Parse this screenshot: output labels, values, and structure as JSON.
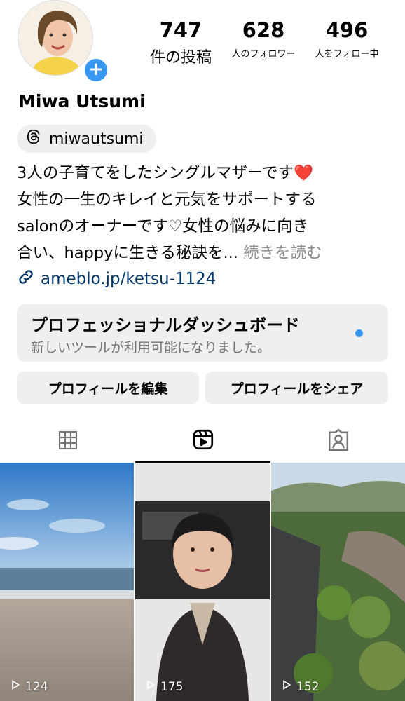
{
  "profile": {
    "name": "Miwa Utsumi",
    "add_badge": "+"
  },
  "stats": {
    "posts_count": "747",
    "posts_label": "件の投稿",
    "followers_count": "628",
    "followers_label": "人のフォロワー",
    "following_count": "496",
    "following_label": "人をフォロー中"
  },
  "threads": {
    "icon": "threads-icon",
    "handle": "miwautsumi"
  },
  "bio": {
    "line1": "3人の子育てをしたシングルマザーです❤️",
    "line2": "女性の一生のキレイと元気をサポートする",
    "line3": "salonのオーナーです♡女性の悩みに向き",
    "line4": "合い、happyに生きる秘訣を...",
    "more": "続きを読む"
  },
  "link": {
    "icon": "link-icon",
    "text": "ameblo.jp/ketsu-1124"
  },
  "dashboard": {
    "title": "プロフェッショナルダッシュボード",
    "subtitle": "新しいツールが利用可能になりました。",
    "dot_color": "#3897f0"
  },
  "buttons": {
    "edit": "プロフィールを編集",
    "share": "プロフィールをシェア"
  },
  "tabs": [
    {
      "icon": "grid-icon",
      "selected": false
    },
    {
      "icon": "reels-icon",
      "selected": true
    },
    {
      "icon": "tagged-icon",
      "selected": false
    }
  ],
  "reels": [
    {
      "views": "124"
    },
    {
      "views": "175"
    },
    {
      "views": "152"
    }
  ],
  "colors": {
    "accent": "#3897f0",
    "link": "#00376b",
    "chip_bg": "#efefef",
    "muted_text": "#737373"
  }
}
